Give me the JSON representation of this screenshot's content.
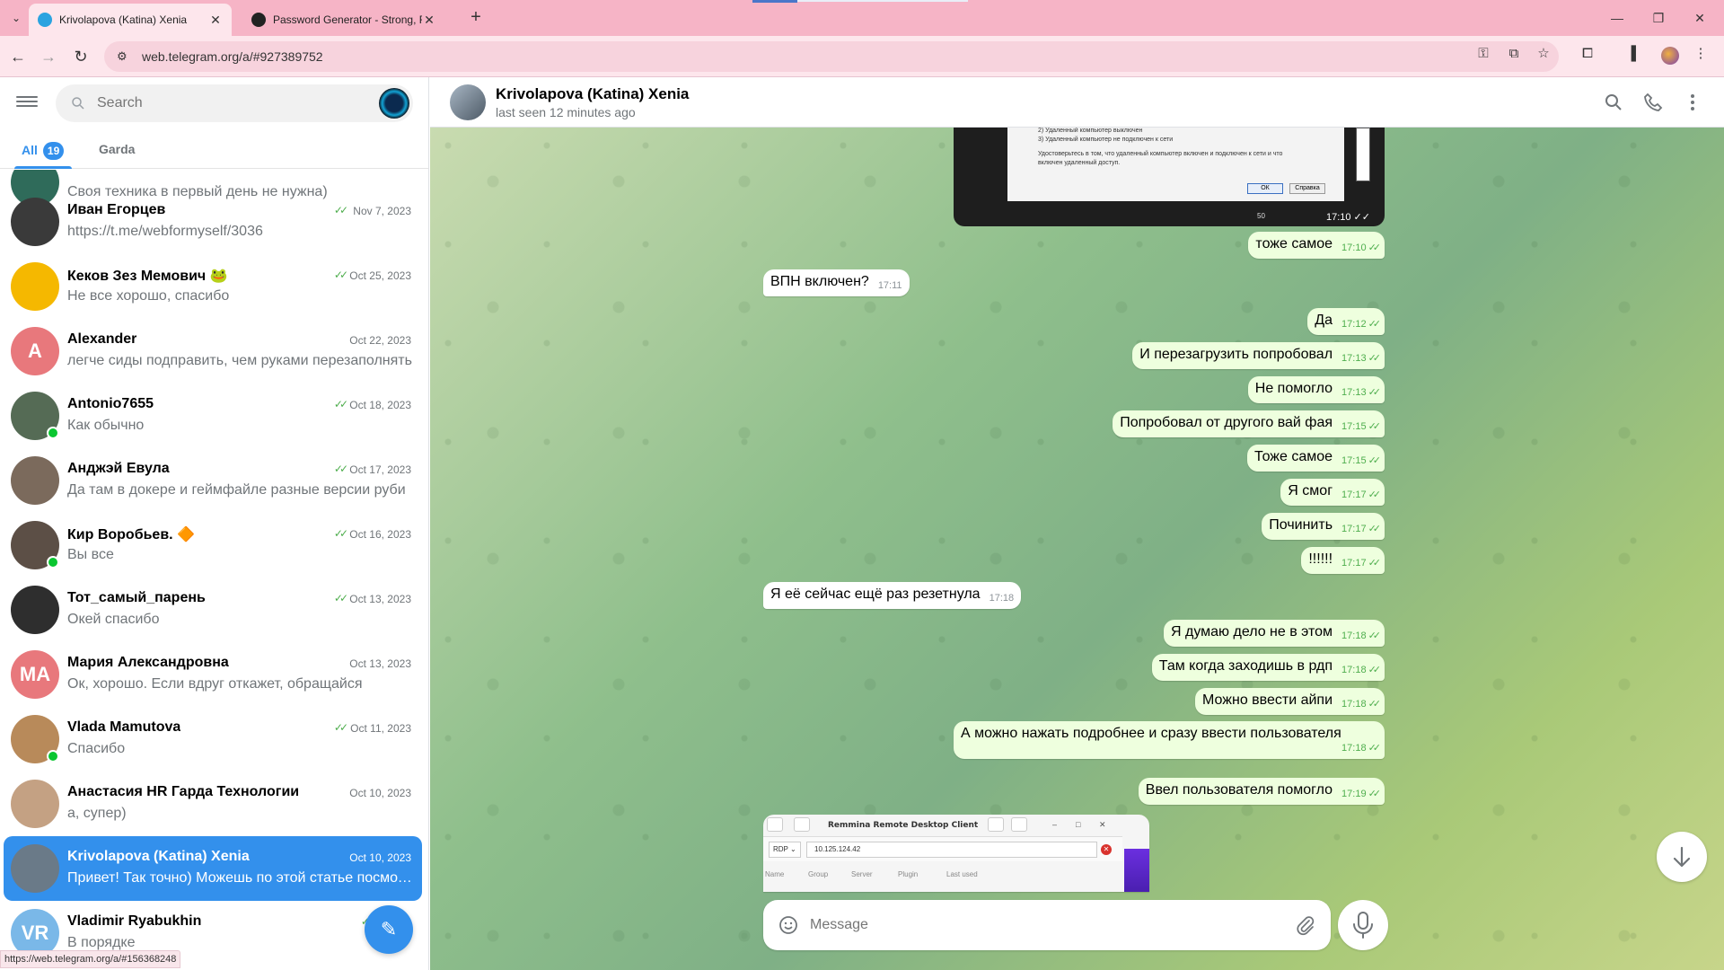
{
  "browser": {
    "tabs": [
      {
        "title": "Krivolapova (Katina) Xenia",
        "active": true
      },
      {
        "title": "Password Generator - Strong, R",
        "active": false
      }
    ],
    "url": "web.telegram.org/a/#927389752",
    "status_url": "https://web.telegram.org/a/#156368248"
  },
  "sidebar": {
    "search_placeholder": "Search",
    "folders": [
      {
        "label": "All",
        "count": "19"
      },
      {
        "label": "Garda"
      }
    ],
    "partial_preview": "Своя техника в первый день не нужна)",
    "chats": [
      {
        "name": "Иван Егорцев",
        "date": "Nov 7, 2023",
        "preview": "https://t.me/webformyself/3036",
        "read": true,
        "avatar_color": "#3a3a3a"
      },
      {
        "name": "Кеков Зез Мемович 🐸",
        "date": "Oct 25, 2023",
        "preview": "Не все хорошо, спасибо",
        "read": true,
        "avatar_color": "#f5b800"
      },
      {
        "name": "Alexander",
        "date": "Oct 22, 2023",
        "preview": "легче сиды подправить, чем руками перезаполнять",
        "read": false,
        "avatar_letter": "A",
        "avatar_color": "#e8787c"
      },
      {
        "name": "Antonio7655",
        "date": "Oct 18, 2023",
        "preview": "Как обычно",
        "read": true,
        "online": true,
        "avatar_color": "#556b55"
      },
      {
        "name": "Анджэй Евула",
        "date": "Oct 17, 2023",
        "preview": "Да там в докере и геймфайле разные версии руби",
        "read": true,
        "avatar_color": "#7b6a5c"
      },
      {
        "name": "Кир Воробьев. 🔶",
        "date": "Oct 16, 2023",
        "preview": "Вы все",
        "read": true,
        "online": true,
        "avatar_color": "#5c4f46"
      },
      {
        "name": "Тот_самый_парень",
        "date": "Oct 13, 2023",
        "preview": "Окей спасибо",
        "read": true,
        "avatar_color": "#2e2e2e"
      },
      {
        "name": "Мария Александровна",
        "date": "Oct 13, 2023",
        "preview": "Ок, хорошо. Если вдруг откажет, обращайся",
        "read": false,
        "avatar_letter": "MA",
        "avatar_color": "#e8787c"
      },
      {
        "name": "Vlada Mamutova",
        "date": "Oct 11, 2023",
        "preview": "Спасибо",
        "read": true,
        "online": true,
        "avatar_color": "#b88a5a"
      },
      {
        "name": "Анастасия HR Гарда Технологии",
        "date": "Oct 10, 2023",
        "preview": "а, супер)",
        "read": false,
        "avatar_color": "#c4a183"
      },
      {
        "name": "Krivolapova (Katina) Xenia",
        "date": "Oct 10, 2023",
        "preview": "Привет! Так точно) Можешь по этой статье посмотреть",
        "read": false,
        "active": true,
        "avatar_color": "#6a7a88"
      },
      {
        "name": "Vladimir Ryabukhin",
        "date": "Oct",
        "preview": "В порядке",
        "read": true,
        "avatar_letter": "VR",
        "avatar_color": "#7ab8e8"
      }
    ]
  },
  "chat": {
    "name": "Krivolapova (Katina) Xenia",
    "status": "last seen 12 minutes ago",
    "composer_placeholder": "Message",
    "image1_time": "17:10",
    "image1_lines": [
      "2) Удаленный компьютер выключен",
      "3) Удаленный компьютер не подключен к сети",
      "Удостоверьтесь в том, что удаленный компьютер включен и подключен к сети и что",
      "включен удаленный доступ."
    ],
    "image1_ok": "ОК",
    "image1_help": "Справка",
    "image1_counter": "50",
    "messages": [
      {
        "text": "тоже самое",
        "time": "17:10",
        "dir": "out"
      },
      {
        "text": "ВПН включен?",
        "time": "17:11",
        "dir": "in"
      },
      {
        "text": "Да",
        "time": "17:12",
        "dir": "out"
      },
      {
        "text": "И перезагрузить попробовал",
        "time": "17:13",
        "dir": "out"
      },
      {
        "text": "Не помогло",
        "time": "17:13",
        "dir": "out"
      },
      {
        "text": "Попробовал от другого вай фая",
        "time": "17:15",
        "dir": "out"
      },
      {
        "text": "Тоже самое",
        "time": "17:15",
        "dir": "out"
      },
      {
        "text": "Я смог",
        "time": "17:17",
        "dir": "out"
      },
      {
        "text": "Починить",
        "time": "17:17",
        "dir": "out"
      },
      {
        "text": "!!!!!!",
        "time": "17:17",
        "dir": "out"
      },
      {
        "text": "Я её сейчас ещё раз резетнула",
        "time": "17:18",
        "dir": "in"
      },
      {
        "text": "Я думаю дело не в этом",
        "time": "17:18",
        "dir": "out"
      },
      {
        "text": "Там когда заходишь в рдп",
        "time": "17:18",
        "dir": "out"
      },
      {
        "text": "Можно ввести айпи",
        "time": "17:18",
        "dir": "out"
      },
      {
        "text": "А можно нажать подробнее и сразу ввести пользователя",
        "time": "17:18",
        "dir": "out"
      },
      {
        "text": "Ввел пользователя помогло",
        "time": "17:19",
        "dir": "out"
      }
    ],
    "remmina": {
      "title": "Remmina Remote Desktop Client",
      "protocol": "RDP",
      "address": "10.125.124.42",
      "columns": [
        "Name",
        "Group",
        "Server",
        "Plugin",
        "Last used"
      ]
    }
  },
  "colors": {
    "accent": "#3390ec",
    "outgoing_bubble": "#eeffde",
    "read_check": "#4fae4e",
    "browser_frame": "#f6b4c6"
  }
}
